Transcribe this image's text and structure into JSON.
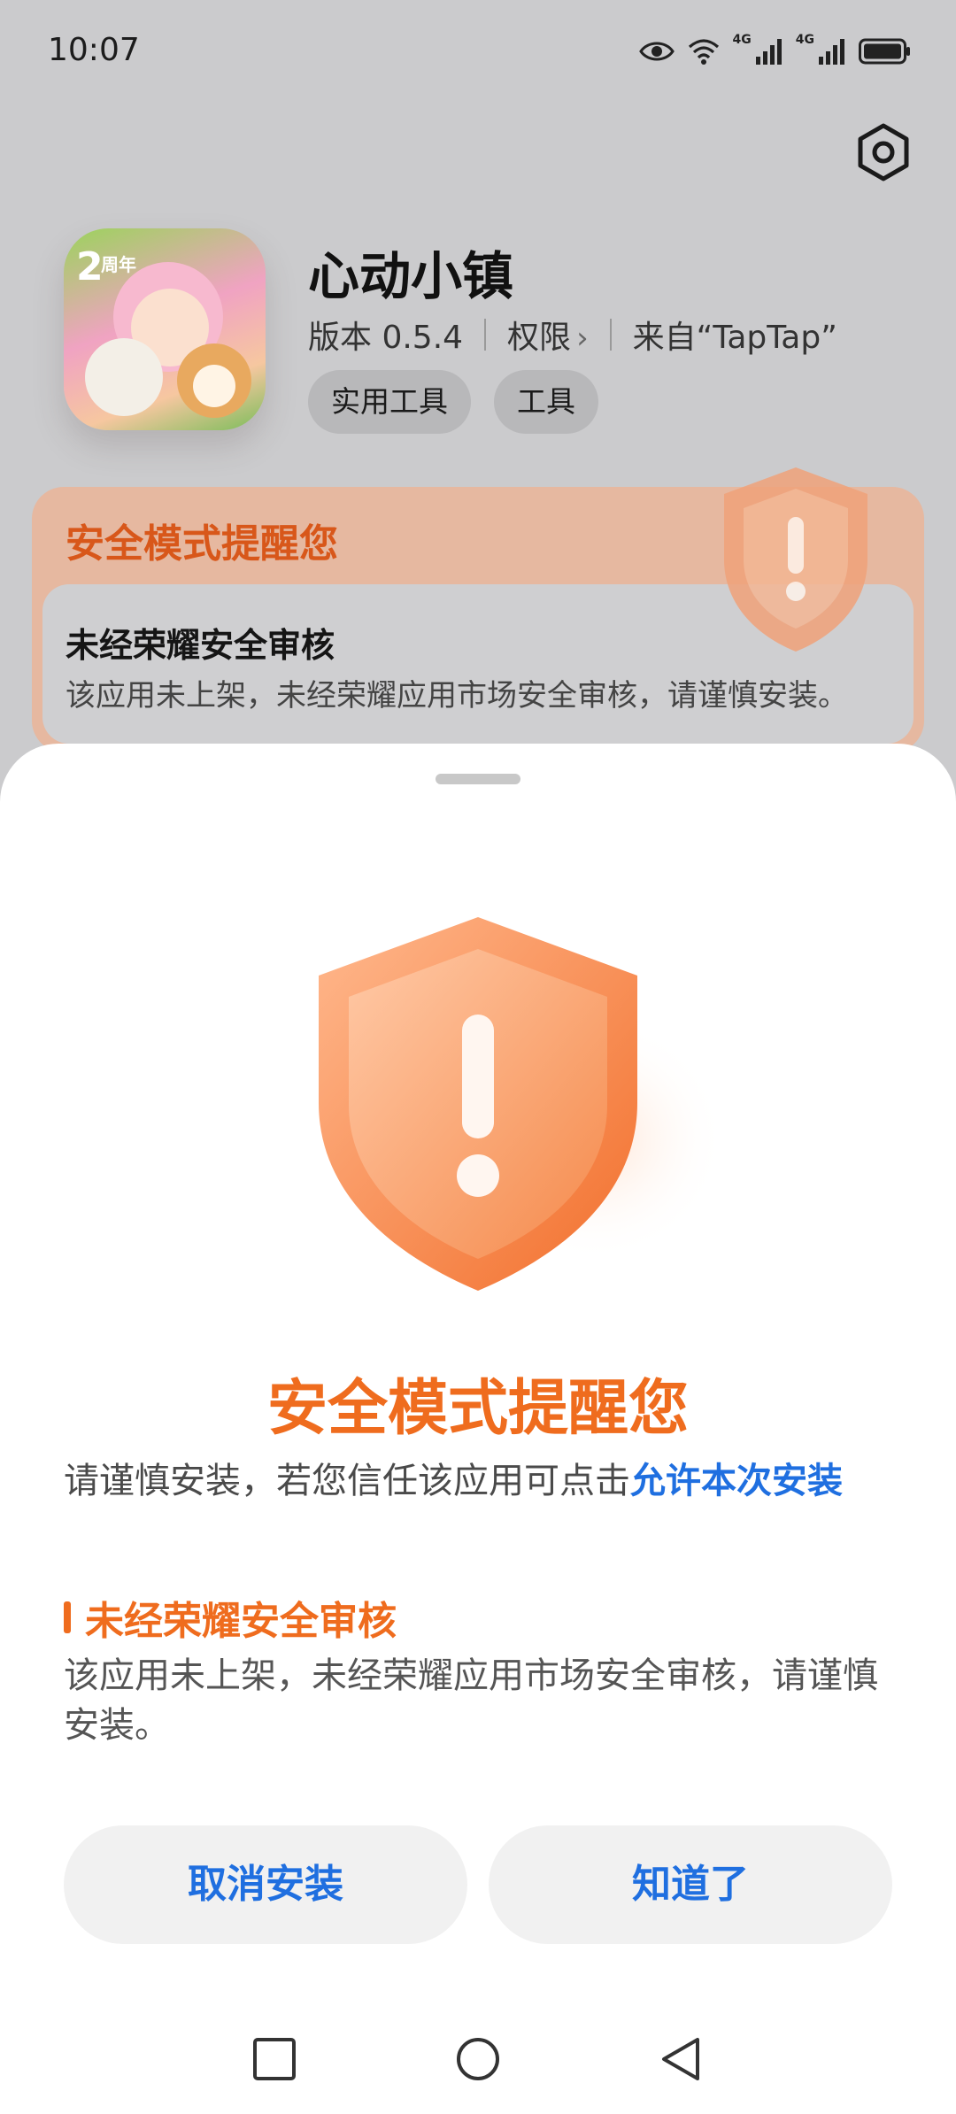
{
  "status_bar": {
    "time": "10:07",
    "network_1": "4G",
    "network_2": "4G",
    "icons": [
      "eye-icon",
      "wifi-icon",
      "signal-icon",
      "signal-icon",
      "battery-icon"
    ]
  },
  "header": {
    "settings_icon": "gear-icon"
  },
  "app": {
    "name": "心动小镇",
    "version": "版本 0.5.4",
    "permissions": "权限",
    "source": "来自“TapTap”",
    "tags": [
      "实用工具",
      "工具"
    ]
  },
  "warning_card": {
    "title": "安全模式提醒您",
    "item_title": "未经荣耀安全审核",
    "item_desc": "该应用未上架，未经荣耀应用市场安全审核，请谨慎安装。"
  },
  "sheet": {
    "title": "安全模式提醒您",
    "subtitle_prefix": "请谨慎安装，若您信任该应用可点击",
    "subtitle_link": "允许本次安装",
    "reason_title": "未经荣耀安全审核",
    "reason_desc": "该应用未上架，未经荣耀应用市场安全审核，请谨慎安装。",
    "cancel_label": "取消安装",
    "ok_label": "知道了"
  },
  "colors": {
    "accent_orange": "#ef6c1e",
    "link_blue": "#1f6fe0"
  },
  "nav": {
    "icons": [
      "recent-apps-icon",
      "home-icon",
      "back-icon"
    ]
  }
}
